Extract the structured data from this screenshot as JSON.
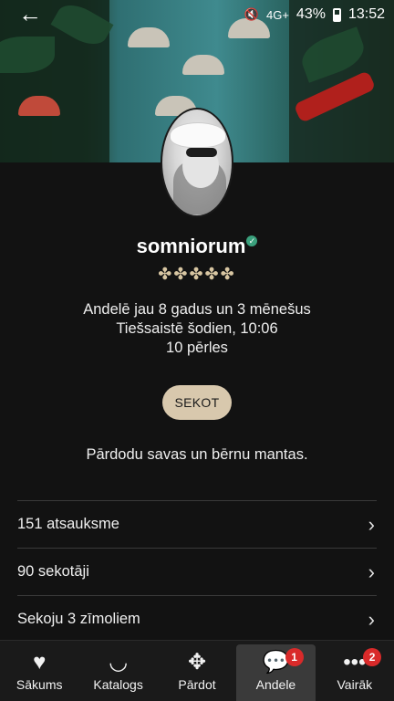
{
  "status_bar": {
    "network": "4G+",
    "battery": "43%",
    "time": "13:52"
  },
  "profile": {
    "username": "somniorum",
    "verified": true,
    "rating_stars": 5,
    "stars_text": "✤✤✤✤✤",
    "member_since": "Andelē jau 8 gadus un 3 mēnešus",
    "last_online": "Tiešsaistē šodien, 10:06",
    "pearls": "10 pērles",
    "follow_label": "SEKOT",
    "bio": "Pārdodu savas un bērnu mantas."
  },
  "links": [
    {
      "label": "151 atsauksme"
    },
    {
      "label": "90 sekotāji"
    },
    {
      "label": "Sekoju 3 zīmoliem"
    }
  ],
  "nav": [
    {
      "label": "Sākums",
      "icon": "heart-icon",
      "glyph": "♥"
    },
    {
      "label": "Katalogs",
      "icon": "necklace-icon",
      "glyph": "◡"
    },
    {
      "label": "Pārdot",
      "icon": "diamond-flower-icon",
      "glyph": "✥"
    },
    {
      "label": "Andele",
      "icon": "chat-bubble-icon",
      "glyph": "💬",
      "badge": "1",
      "active": true
    },
    {
      "label": "Vairāk",
      "icon": "more-dots-icon",
      "glyph": "•••",
      "badge": "2"
    }
  ],
  "colors": {
    "background": "#121212",
    "follow_button": "#d8c8ad",
    "stars": "#d8c6a2",
    "verified": "#3aa07c",
    "badge": "#d92a2a"
  }
}
